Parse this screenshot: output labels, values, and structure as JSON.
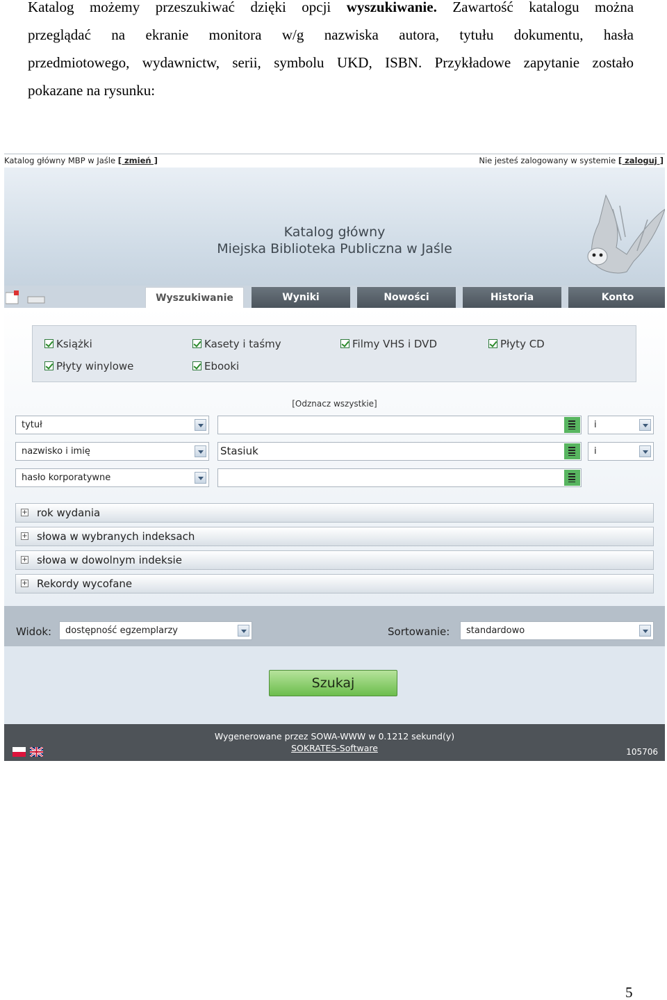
{
  "paragraph": {
    "line1_a": "Katalog możemy przeszukiwać dzięki opcji",
    "line1_bold": "wyszukiwanie.",
    "line1_b": "Zawartość katalogu można",
    "line2": "przeglądać na ekranie monitora w/g nazwiska autora, tytułu dokumentu, hasła",
    "line3": "przedmiotowego, wydawnictw, serii, symbolu UKD, ISBN. Przykładowe zapytanie zostało",
    "line4": "pokazane na rysunku:"
  },
  "screenshot": {
    "topbar_left_text": "Katalog główny MBP w Jaśle",
    "topbar_left_link": "[ zmień ]",
    "topbar_right_text": "Nie jesteś zalogowany w systemie",
    "topbar_right_link": "[ zaloguj ]",
    "banner_title": "Katalog główny",
    "banner_subtitle": "Miejska Biblioteka Publiczna w Jaśle",
    "tabs": [
      "Wyszukiwanie",
      "Wyniki",
      "Nowości",
      "Historia",
      "Konto"
    ],
    "doc_types": [
      "Książki",
      "Kasety i taśmy",
      "Filmy VHS i DVD",
      "Płyty CD",
      "Płyty winylowe",
      "Ebooki"
    ],
    "uncheck_all": "[Odznacz wszystkie]",
    "search_rows": [
      {
        "field": "tytuł",
        "value": "",
        "op": "i"
      },
      {
        "field": "nazwisko i imię",
        "value": "Stasiuk",
        "op": "i"
      },
      {
        "field": "hasło korporatywne",
        "value": ""
      }
    ],
    "expanders": [
      "rok wydania",
      "słowa w wybranych indeksach",
      "słowa w dowolnym indeksie",
      "Rekordy wycofane"
    ],
    "view_label": "Widok:",
    "view_value": "dostępność egzemplarzy",
    "sort_label": "Sortowanie:",
    "sort_value": "standardowo",
    "search_button": "Szukaj",
    "footer_generated": "Wygenerowane przez SOWA-WWW w 0.1212 sekund(y)",
    "footer_software": "SOKRATES-Software",
    "footer_number": "105706"
  },
  "page_number": "5"
}
